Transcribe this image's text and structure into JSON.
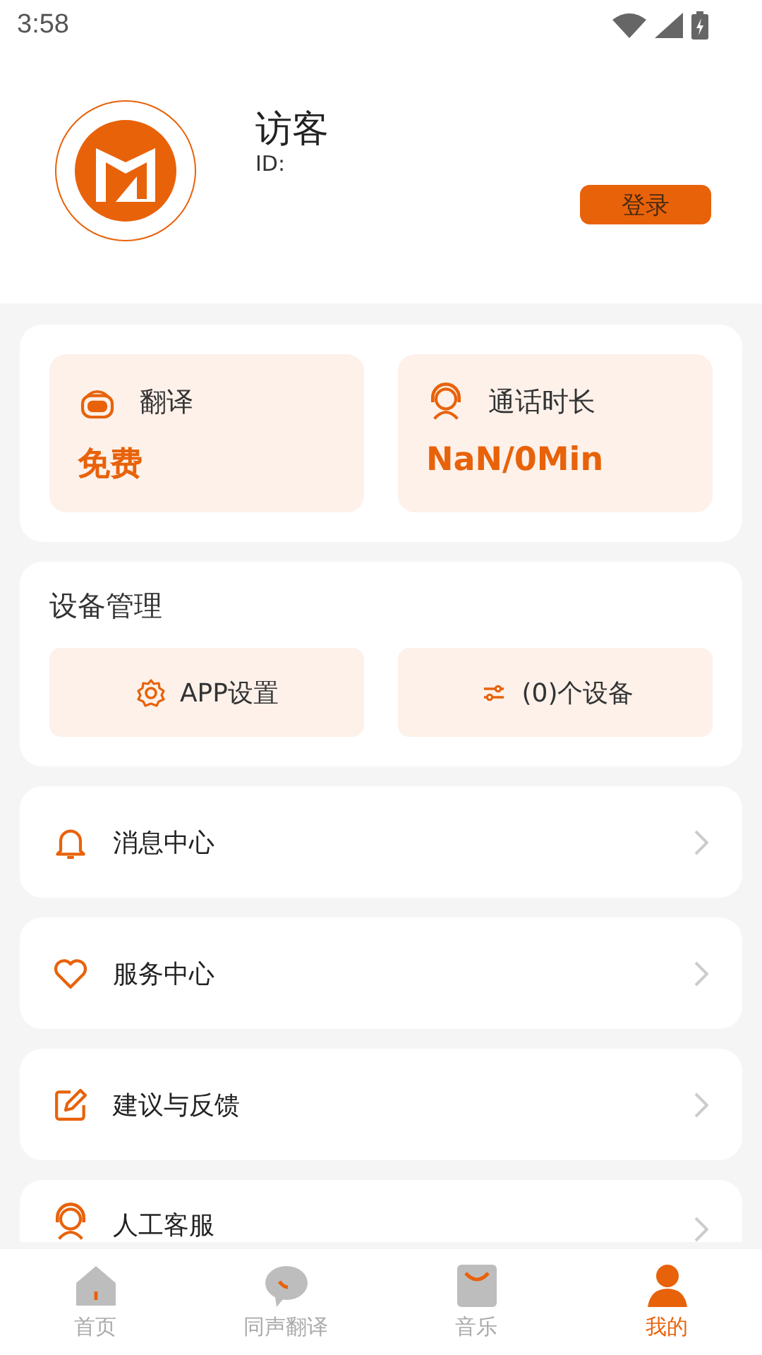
{
  "status_bar": {
    "time": "3:58"
  },
  "profile": {
    "name": "访客",
    "id_label": "ID:",
    "login_button": "登录"
  },
  "stats": [
    {
      "kind": "translate",
      "label": "翻译",
      "value": "免费"
    },
    {
      "kind": "call",
      "label": "通话时长",
      "value": "NaN/0Min"
    }
  ],
  "device_management": {
    "title": "设备管理",
    "buttons": [
      {
        "kind": "settings",
        "label": "APP设置"
      },
      {
        "kind": "devices",
        "label": "(0)个设备"
      }
    ]
  },
  "menu": [
    {
      "kind": "bell",
      "label": "消息中心"
    },
    {
      "kind": "heart",
      "label": "服务中心"
    },
    {
      "kind": "edit",
      "label": "建议与反馈"
    },
    {
      "kind": "headset",
      "label": "人工客服"
    }
  ],
  "tabs": [
    {
      "kind": "home",
      "label": "首页",
      "selected": false
    },
    {
      "kind": "chat",
      "label": "同声翻译",
      "selected": false
    },
    {
      "kind": "bag",
      "label": "音乐",
      "selected": false
    },
    {
      "kind": "person",
      "label": "我的",
      "selected": true
    }
  ]
}
